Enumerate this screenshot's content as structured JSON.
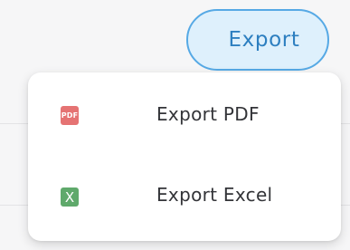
{
  "toolbar": {
    "export_label": "Export"
  },
  "export_menu": {
    "items": [
      {
        "label": "Export PDF",
        "icon": "pdf-file-icon",
        "icon_text": "PDF",
        "icon_color": "#e57373"
      },
      {
        "label": "Export Excel",
        "icon": "excel-file-icon",
        "icon_text": "X",
        "icon_color": "#5fa96b"
      }
    ]
  },
  "colors": {
    "accent": "#2d7fc0",
    "button_bg": "#def0fc",
    "button_border": "#56a9e5"
  }
}
